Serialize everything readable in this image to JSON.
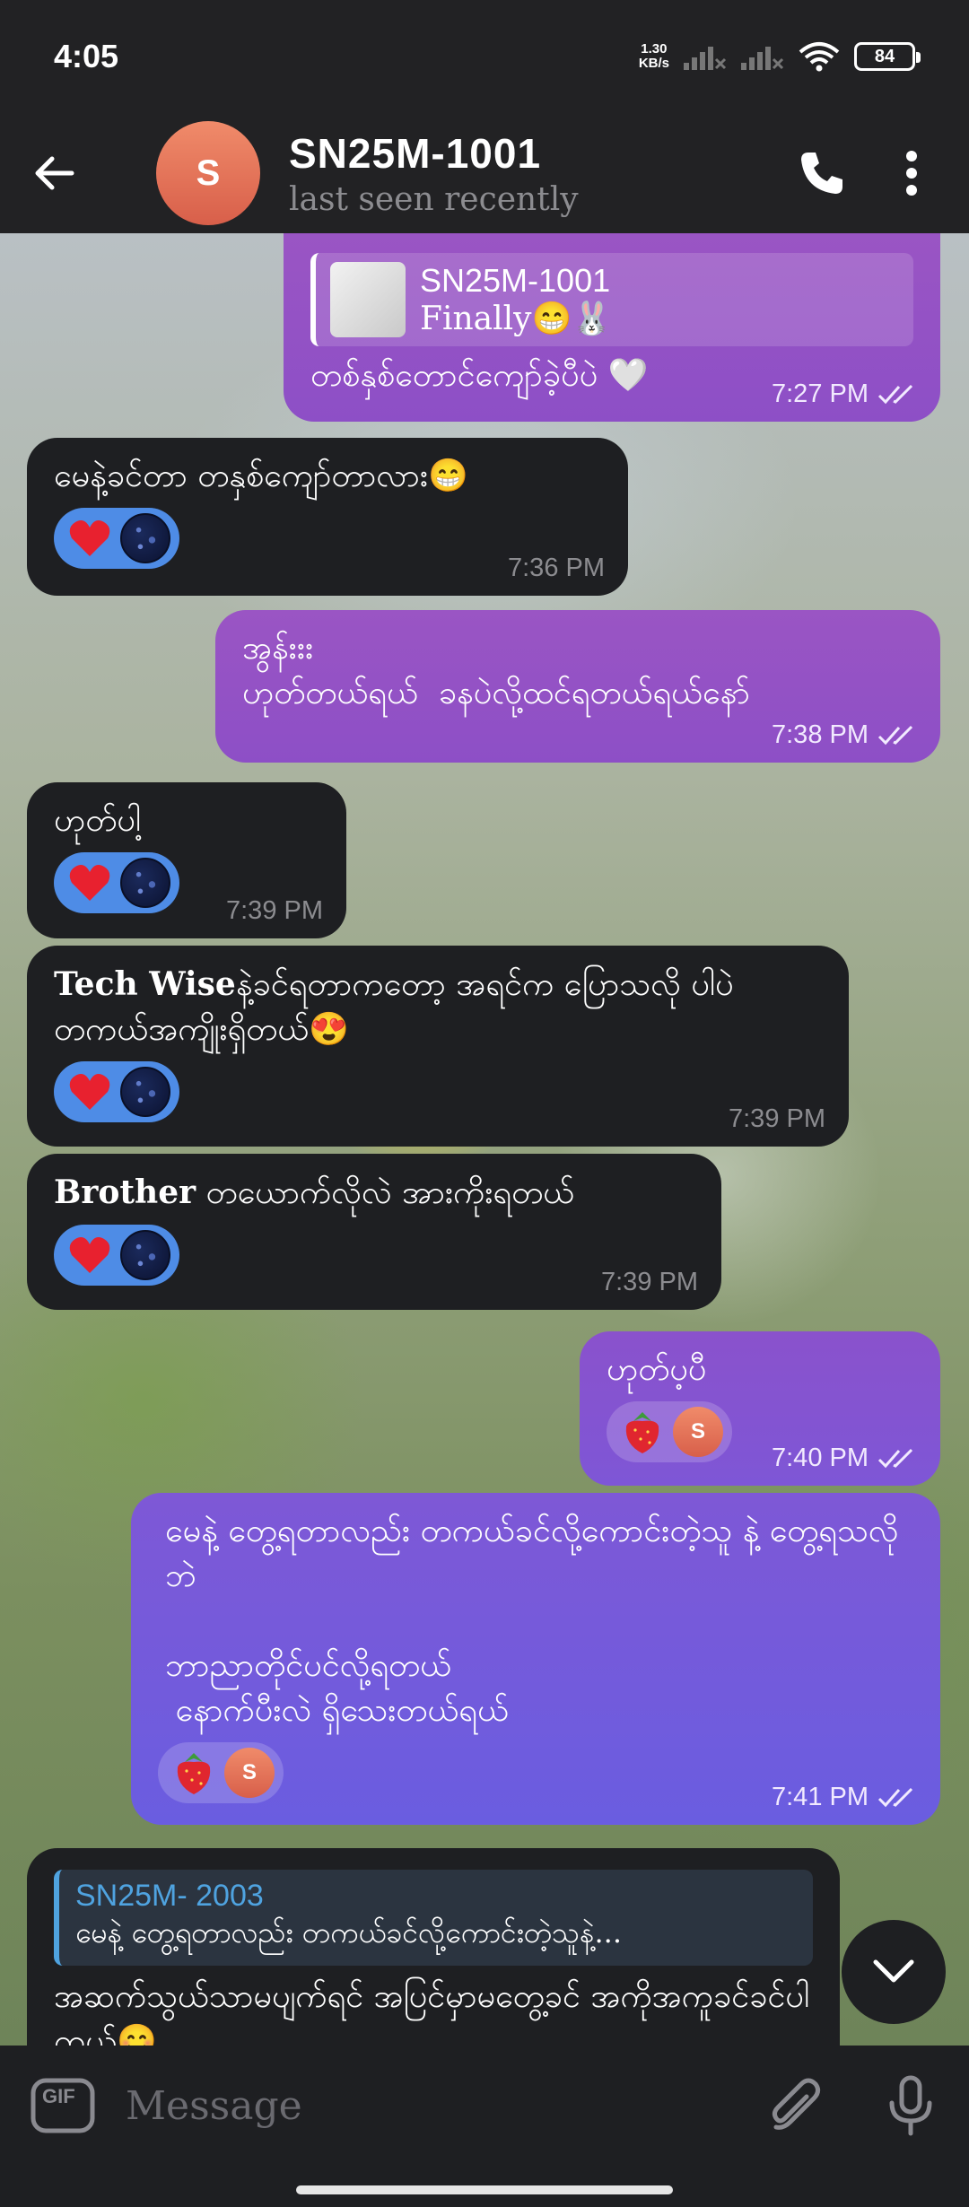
{
  "status_bar": {
    "time": "4:05",
    "net_speed_value": "1.30",
    "net_speed_unit": "KB/s",
    "battery": "84"
  },
  "header": {
    "avatar_letter": "S",
    "title": "SN25M-1001",
    "subtitle": "last seen recently"
  },
  "messages": [
    {
      "direction": "out",
      "reply_name": "SN25M-1001",
      "reply_text": "Finally😁🐰",
      "text": "တစ်နှစ်တောင်ကျော်ခဲ့ပီပဲ 🤍",
      "time": "7:27 PM"
    },
    {
      "direction": "in",
      "text": "မေနဲ့ခင်တာ တနှစ်ကျော်တာလား😁",
      "reaction": "❤️",
      "time": "7:36 PM"
    },
    {
      "direction": "out",
      "text": "အွန်းးး\nဟုတ်တယ်ရယ်  ခနပဲလို့ထင်ရတယ်ရယ်နော်",
      "time": "7:38 PM"
    },
    {
      "direction": "in",
      "text": "ဟုတ်ပါ့",
      "reaction": "❤️",
      "time": "7:39 PM"
    },
    {
      "direction": "in",
      "bold": "Tech Wise",
      "text": "နဲ့ခင်ရတာကတော့ အရင်က ပြောသလို ပါပဲ တကယ်အကျိုးရှိတယ်😍",
      "reaction": "❤️",
      "time": "7:39 PM"
    },
    {
      "direction": "in",
      "bold": "Brother",
      "text": " တယောက်လိုလဲ အားကိုးရတယ်",
      "reaction": "❤️",
      "time": "7:39 PM"
    },
    {
      "direction": "out",
      "text": "ဟုတ်ပ့ပီ",
      "reaction": "🍓",
      "reaction_user": "S",
      "time": "7:40 PM"
    },
    {
      "direction": "out",
      "text": "မေနဲ့ တွေ့ရတာလည်း တကယ်ခင်လို့ကောင်းတဲ့သူ နဲ့ တွေ့ရသလိုဘဲ\n\nဘာညာတိုင်ပင်လို့ရတယ်\n နောက်ပီးလဲ ရှိသေးတယ်ရယ်",
      "reaction": "🍓",
      "reaction_user": "S",
      "time": "7:41 PM"
    },
    {
      "direction": "in",
      "reply_name": "SN25M- 2003",
      "reply_text": "မေနဲ့ တွေ့ရတာလည်း တကယ်ခင်လို့ကောင်းတဲ့သူနဲ့...",
      "text": "အဆက်သွယ်သာမပျက်ရင် အပြင်မှာမတွေ့ခင် အကိုအကူခင်ခင်ပါကွယ်😊"
    }
  ],
  "input": {
    "placeholder": "Message",
    "gif_label": "GIF"
  },
  "icons": {
    "back": "arrow-left-icon",
    "call": "phone-icon",
    "menu": "more-vertical-icon",
    "attach": "paperclip-icon",
    "mic": "microphone-icon",
    "scroll": "chevron-down-icon"
  },
  "colors": {
    "outgoing_bubble": "#8d4fc6",
    "outgoing_bubble_alt": "#6a5de0",
    "incoming_bubble": "#1e1f22",
    "reaction_pill": "#4e8ce6",
    "reply_name_in": "#4fa3e0"
  }
}
